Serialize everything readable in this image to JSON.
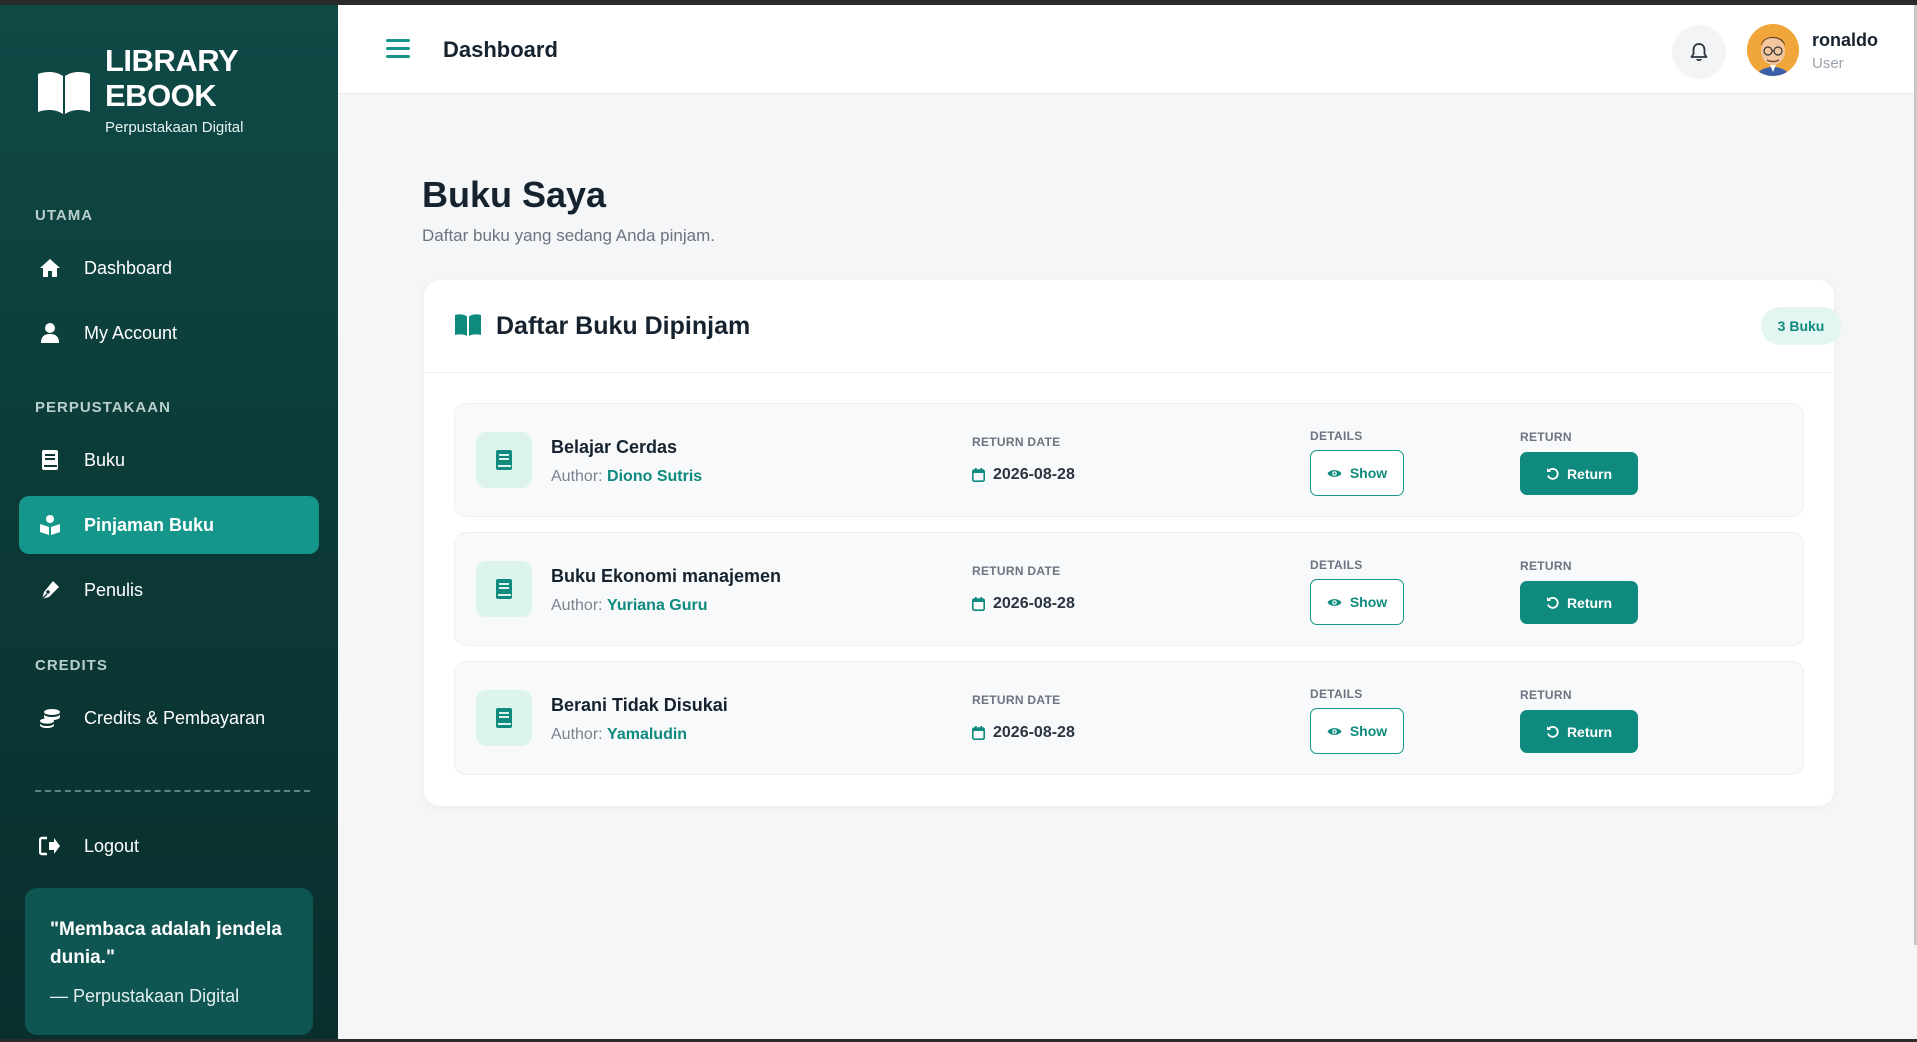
{
  "sidebar": {
    "brand_title": "LIBRARY EBOOK",
    "brand_subtitle": "Perpustakaan Digital",
    "sections": {
      "utama": "UTAMA",
      "perpustakaan": "PERPUSTAKAAN",
      "credits": "CREDITS"
    },
    "items": [
      {
        "label": "Dashboard",
        "icon": "home-icon"
      },
      {
        "label": "My Account",
        "icon": "user-icon"
      },
      {
        "label": "Buku",
        "icon": "book-icon"
      },
      {
        "label": "Pinjaman Buku",
        "icon": "reader-icon",
        "active": true
      },
      {
        "label": "Penulis",
        "icon": "pen-icon"
      },
      {
        "label": "Credits & Pembayaran",
        "icon": "coins-icon"
      },
      {
        "label": "Logout",
        "icon": "logout-icon"
      }
    ],
    "quote": {
      "text": "\"Membaca adalah jendela dunia.\"",
      "source": "— Perpustakaan Digital"
    }
  },
  "topbar": {
    "title": "Dashboard",
    "user_name": "ronaldo",
    "user_role": "User"
  },
  "page": {
    "title": "Buku Saya",
    "subtitle": "Daftar buku yang sedang Anda pinjam."
  },
  "card": {
    "title": "Daftar Buku Dipinjam",
    "badge": "3 Buku",
    "labels": {
      "return_date": "RETURN DATE",
      "details": "DETAILS",
      "return": "RETURN",
      "author_prefix": "Author:"
    },
    "show_label": "Show",
    "return_label": "Return",
    "books": [
      {
        "title": "Belajar Cerdas",
        "author": "Diono Sutris",
        "return_date": "2026-08-28"
      },
      {
        "title": "Buku Ekonomi manajemen",
        "author": "Yuriana Guru",
        "return_date": "2026-08-28"
      },
      {
        "title": "Berani Tidak Disukai",
        "author": "Yamaludin",
        "return_date": "2026-08-28"
      }
    ]
  },
  "colors": {
    "accent": "#14968a",
    "accent_dark": "#0f8a7e",
    "sidebar_bg": "#0b3835"
  }
}
